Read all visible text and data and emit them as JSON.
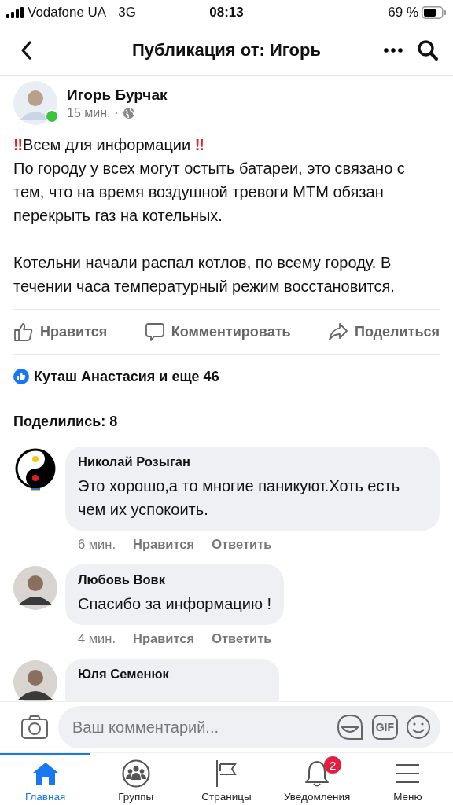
{
  "status_bar": {
    "carrier": "Vodafone UA",
    "network": "3G",
    "time": "08:13",
    "battery": "69 %"
  },
  "header": {
    "title": "Публикация от: Игорь"
  },
  "post": {
    "author": "Игорь Бурчак",
    "online": true,
    "time": "15 мин.",
    "separator": "·",
    "headline": {
      "mark": "‼",
      "text": "Всем для информации"
    },
    "paragraphs": [
      "По городу у всех могут остыть батареи, это связано с тем, что на время воздушной тревоги МТМ обязан перекрыть газ на котельных.",
      "Котельни  начали распал котлов, по всему городу. В течении часа температурный режим восстановится."
    ],
    "actions": [
      {
        "kind": "like",
        "label": "Нравится"
      },
      {
        "kind": "comment",
        "label": "Комментировать"
      },
      {
        "kind": "share",
        "label": "Поделиться"
      }
    ],
    "reactions": "Куташ Анастасия и еще 46",
    "shares": "Поделились: 8"
  },
  "comments": [
    {
      "kind": "yinyang",
      "name": "Николай Розыган",
      "text": "Это хорошо,а то многие паникуют.Хоть есть чем их успокоить.",
      "time": "6 мин.",
      "like": "Нравится",
      "reply": "Ответить"
    },
    {
      "kind": "person",
      "name": "Любовь Вовк",
      "text": "Спасибо за информацию !",
      "time": "4 мин.",
      "like": "Нравится",
      "reply": "Ответить"
    },
    {
      "kind": "person",
      "name": "Юля Семенюк"
    }
  ],
  "comment_bar": {
    "placeholder": "Ваш комментарий...",
    "gif": "GIF"
  },
  "tabs": [
    {
      "kind": "home",
      "label": "Главная",
      "selected": true
    },
    {
      "kind": "groups",
      "label": "Группы",
      "selected": false
    },
    {
      "kind": "pages",
      "label": "Страницы",
      "selected": false
    },
    {
      "kind": "bell",
      "label": "Уведомления",
      "selected": false,
      "badge": "2"
    },
    {
      "kind": "menu",
      "label": "Меню",
      "selected": false
    }
  ]
}
